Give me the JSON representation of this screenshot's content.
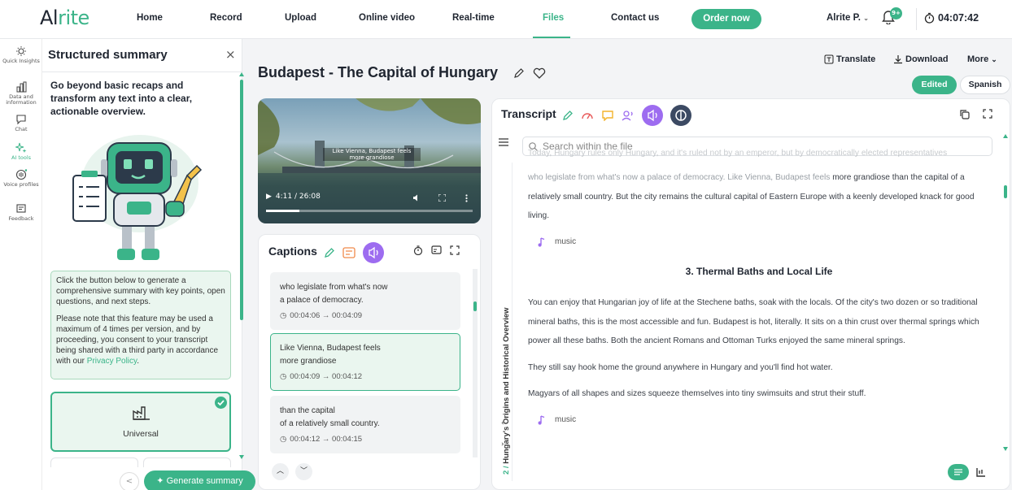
{
  "brand": {
    "logo_pre": "Al",
    "logo_post": "rite"
  },
  "nav": {
    "items": [
      "Home",
      "Record",
      "Upload",
      "Online video",
      "Real-time",
      "Files",
      "Contact us"
    ],
    "active": "Files",
    "order_label": "Order now",
    "user": "Alrite P.",
    "notif_badge": "9+",
    "timer": "04:07:42"
  },
  "rail": {
    "items": [
      "Quick Insights",
      "Data and information",
      "Chat",
      "AI tools",
      "Voice profiles",
      "Feedback"
    ],
    "active": "AI tools"
  },
  "summary": {
    "title": "Structured summary",
    "close": "×",
    "intro": "Go beyond basic recaps and transform any text into a clear, actionable overview.",
    "info_p1": "Click the button below to generate a comprehensive summary with key points, open questions, and next steps.",
    "info_p2_pre": "Please note that this feature may be used a maximum of 4 times per version, and by proceeding, you consent to your transcript being shared with a third party in accordance with our ",
    "info_link": "Privacy Policy",
    "info_p2_post": ".",
    "option_label": "Universal",
    "generate_label": "Generate summary"
  },
  "header": {
    "title": "Budapest - The Capital of Hungary",
    "translate": "Translate",
    "download": "Download",
    "more": "More",
    "version_edited": "Edited",
    "language": "Spanish"
  },
  "video": {
    "subtitle_line1": "Like Vienna, Budapest feels",
    "subtitle_line2": "more grandiose",
    "time": "4:11 / 26:08",
    "progress": 0.16
  },
  "captions": {
    "title": "Captions",
    "items": [
      {
        "line1": "who legislate from what's now",
        "line2": "a palace of democracy.",
        "time": "00:04:06 → 00:04:09"
      },
      {
        "line1": "Like Vienna, Budapest feels",
        "line2": "more grandiose",
        "time": "00:04:09 → 00:04:12"
      },
      {
        "line1": "than the capital",
        "line2": "of a relatively small country.",
        "time": "00:04:12 → 00:04:15"
      }
    ]
  },
  "transcript": {
    "title": "Transcript",
    "search_placeholder": "Search within the file",
    "section_label_num": "2 / ",
    "section_label": "Hungary's Origins and Historical Overview",
    "p0_faded": "Today, Hungary rules only Hungary, and it's ruled not by an emperor, but by democratically elected representatives",
    "p1_faded": "who legislate from what's now a palace of democracy. Like Vienna, Budapest feels ",
    "p1_rest": "more grandiose than the capital of a relatively small country. But the city remains the cultural capital of Eastern Europe with a keenly developed knack for good living.",
    "music1": "music",
    "heading": "3.  Thermal Baths and Local Life",
    "p2": "You can enjoy that Hungarian joy of life at the Stechene baths, soak with the locals. Of the city's two dozen or so traditional mineral baths, this is the most accessible and fun. Budapest is hot, literally. It sits on a thin crust over thermal springs which power all these baths. Both the ancient Romans and Ottoman Turks enjoyed the same mineral springs.",
    "p3": "They still say hook home the ground anywhere in Hungary and you'll find hot water.",
    "p4": "Magyars of all shapes and sizes squeeze themselves into tiny swimsuits and strut their stuff.",
    "music2": "music"
  },
  "colors": {
    "accent": "#3bb489",
    "purple": "#9d6cf0",
    "orange": "#f08a4b",
    "dark": "#3c4a63"
  }
}
